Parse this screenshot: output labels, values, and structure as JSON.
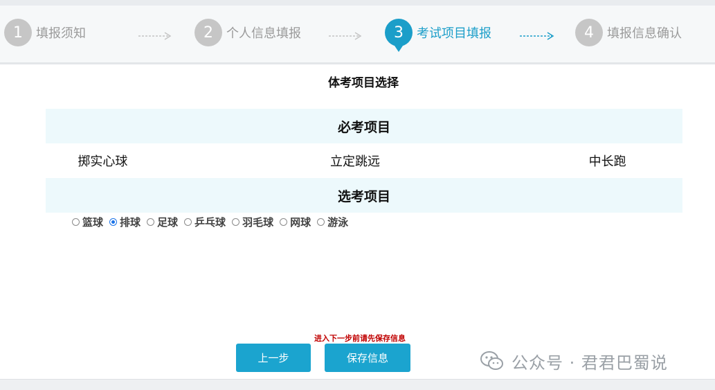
{
  "steps": [
    {
      "num": "1",
      "label": "填报须知"
    },
    {
      "num": "2",
      "label": "个人信息填报"
    },
    {
      "num": "3",
      "label": "考试项目填报"
    },
    {
      "num": "4",
      "label": "填报信息确认"
    }
  ],
  "active_step": 3,
  "page_title": "体考项目选择",
  "required": {
    "heading": "必考项目",
    "items": [
      "掷实心球",
      "立定跳远",
      "中长跑"
    ]
  },
  "optional": {
    "heading": "选考项目",
    "options": [
      "篮球",
      "排球",
      "足球",
      "乒乓球",
      "羽毛球",
      "网球",
      "游泳"
    ],
    "selected": "排球"
  },
  "hint": "进入下一步前请先保存信息",
  "buttons": {
    "prev": "上一步",
    "save": "保存信息"
  },
  "watermark": "公众号 · 君君巴蜀说",
  "colors": {
    "accent": "#1b9ec9",
    "button": "#1ba4cf",
    "band": "#edf9fc",
    "hint": "#c00000"
  }
}
